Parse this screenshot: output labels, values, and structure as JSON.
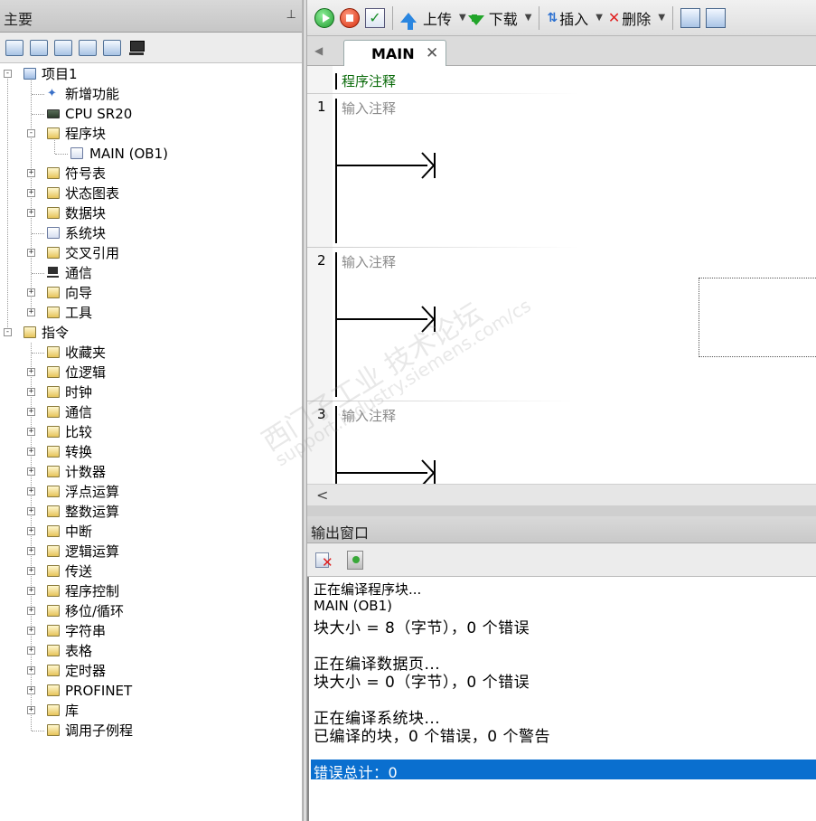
{
  "left_panel": {
    "title": "主要",
    "pin_glyph": "⊥"
  },
  "tree": {
    "project": "项目1",
    "new_features": "新增功能",
    "cpu": "CPU SR20",
    "program_block": "程序块",
    "main_ob1": "MAIN (OB1)",
    "symbol_table": "符号表",
    "status_chart": "状态图表",
    "data_block": "数据块",
    "system_block": "系统块",
    "cross_ref": "交叉引用",
    "communication": "通信",
    "wizard": "向导",
    "tools": "工具",
    "instructions": "指令",
    "favorites": "收藏夹",
    "bit_logic": "位逻辑",
    "clock": "时钟",
    "instr_comm": "通信",
    "compare": "比较",
    "convert": "转换",
    "counter": "计数器",
    "float_math": "浮点运算",
    "int_math": "整数运算",
    "interrupt": "中断",
    "logic_ops": "逻辑运算",
    "move": "传送",
    "prog_control": "程序控制",
    "shift_rotate": "移位/循环",
    "string": "字符串",
    "table": "表格",
    "timer": "定时器",
    "profinet": "PROFINET",
    "library": "库",
    "call_subroutine": "调用子例程"
  },
  "toolbar": {
    "upload": "上传",
    "download": "下载",
    "insert": "插入",
    "delete": "删除"
  },
  "editor": {
    "tab_label": "MAIN",
    "tab_close": "✕",
    "scroll_left": "‹",
    "program_comment": "程序注释",
    "networks": [
      {
        "num": "1",
        "comment": "输入注释"
      },
      {
        "num": "2",
        "comment": "输入注释"
      },
      {
        "num": "3",
        "comment": "输入注释"
      }
    ]
  },
  "hscroll": {
    "left_arrow": "<"
  },
  "output": {
    "title": "输出窗口",
    "lines": [
      "正在编译程序块...",
      "MAIN (OB1)",
      "块大小 = 8（字节），0 个错误",
      "正在编译数据页...",
      "块大小 = 0（字节），0 个错误",
      "正在编译系统块...",
      "已编译的块，0 个错误，0 个警告"
    ],
    "total": "错误总计：0"
  },
  "watermark": {
    "text": "西门子工业  技术论坛",
    "url": "support.industry.siemens.com/cs"
  },
  "colors": {
    "highlight": "#0a6fcf",
    "comment_green": "#0b6b0b"
  }
}
